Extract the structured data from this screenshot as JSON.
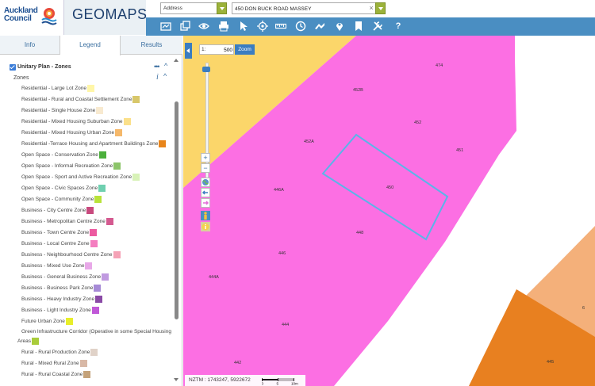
{
  "header": {
    "logo_line1": "Auckland",
    "logo_line2": "Council",
    "app_name": "GEOMAPS",
    "search_type": "Address",
    "search_value": "450 DON BUCK ROAD MASSEY"
  },
  "tabs": [
    {
      "label": "Info"
    },
    {
      "label": "Legend"
    },
    {
      "label": "Results"
    }
  ],
  "legend": {
    "layer_title": "Unitary Plan - Zones",
    "more": "•••",
    "group_label": "Zones",
    "items": [
      {
        "label": "Residential - Large Lot Zone",
        "color": "#fff6a8"
      },
      {
        "label": "Residential - Rural and Coastal Settlement Zone",
        "color": "#d8c76a"
      },
      {
        "label": "Residential - Single House Zone",
        "color": "#f8ead0"
      },
      {
        "label": "Residential - Mixed Housing Suburban Zone",
        "color": "#fbe08a"
      },
      {
        "label": "Residential - Mixed Housing Urban Zone",
        "color": "#f5b86a"
      },
      {
        "label": "Residential -Terrace Housing and Apartment Buildings Zone",
        "color": "#e8851b"
      },
      {
        "label": "Open Space - Conservation Zone",
        "color": "#4caf3c"
      },
      {
        "label": "Open Space - Informal Recreation Zone",
        "color": "#8cc46a"
      },
      {
        "label": "Open Space - Sport and Active Recreation Zone",
        "color": "#d8f2b8"
      },
      {
        "label": "Open Space - Civic Spaces Zone",
        "color": "#6fd0b0"
      },
      {
        "label": "Open Space - Community Zone",
        "color": "#b8e23a"
      },
      {
        "label": "Business - City Centre Zone",
        "color": "#c84a7e"
      },
      {
        "label": "Business - Metropolitan Centre Zone",
        "color": "#d45a90"
      },
      {
        "label": "Business - Town Centre Zone",
        "color": "#ec5aa0"
      },
      {
        "label": "Business - Local Centre Zone",
        "color": "#f47ec0"
      },
      {
        "label": "Business - Neighbourhood Centre Zone",
        "color": "#f5a2b6"
      },
      {
        "label": "Business - Mixed Use Zone",
        "color": "#e8a8e8"
      },
      {
        "label": "Business - General Business Zone",
        "color": "#c09ae0"
      },
      {
        "label": "Business - Business Park Zone",
        "color": "#a68ad6"
      },
      {
        "label": "Business - Heavy Industry Zone",
        "color": "#8a4aa6"
      },
      {
        "label": "Business - Light Industry Zone",
        "color": "#c058d8"
      },
      {
        "label": "Future Urban Zone",
        "color": "#e8ee2a"
      },
      {
        "label": "Green Infrastructure Corridor (Operative in some Special Housing",
        "color": ""
      },
      {
        "label": "Areas",
        "color": "#a9cc3a"
      },
      {
        "label": "Rural - Rural Production Zone",
        "color": "#e0d2c8"
      },
      {
        "label": "Rural - Mixed Rural Zone",
        "color": "#d8b8a6"
      },
      {
        "label": "Rural - Rural Coastal Zone",
        "color": "#c4a27a"
      }
    ]
  },
  "map": {
    "scale_prefix": "1:",
    "scale_value": "500",
    "zoom_label": "Zoom",
    "coords": "NZTM : 1743247, 5922672",
    "scalebar_labels": [
      "0",
      "5",
      "10m"
    ],
    "colors": {
      "pink_zone": "#fc6fe3",
      "yellow_zone": "#fbd66a",
      "orange_zone": "#e88020",
      "light_orange_zone": "#f4b07a",
      "parcel_outline": "#5bb4e8"
    },
    "address_labels": [
      {
        "text": "474"
      },
      {
        "text": "452B"
      },
      {
        "text": "452"
      },
      {
        "text": "452A"
      },
      {
        "text": "451"
      },
      {
        "text": "446A"
      },
      {
        "text": "450"
      },
      {
        "text": "448"
      },
      {
        "text": "446"
      },
      {
        "text": "444A"
      },
      {
        "text": "444"
      },
      {
        "text": "442"
      },
      {
        "text": "445"
      },
      {
        "text": "6"
      }
    ]
  }
}
